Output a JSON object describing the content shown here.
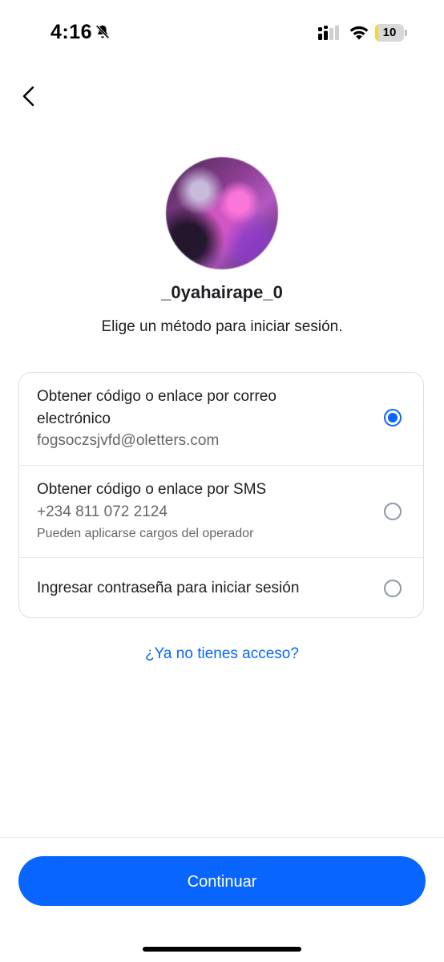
{
  "status_bar": {
    "time": "4:16",
    "battery_level": "10",
    "battery_charge_fraction": 0.1,
    "icons": [
      "bell-off-icon",
      "signal-icon",
      "wifi-icon",
      "battery-icon"
    ]
  },
  "header": {
    "back_icon": "chevron-left-icon"
  },
  "profile": {
    "username": "_0yahairape_0",
    "subtitle": "Elige un método para iniciar sesión."
  },
  "options": [
    {
      "title": "Obtener código o enlace por correo electrónico",
      "detail": "fogsoczsjvfd@oletters.com",
      "selected": true
    },
    {
      "title": "Obtener código o enlace por SMS",
      "detail": "+234 811 072 2124",
      "note": "Pueden aplicarse cargos del operador",
      "selected": false
    },
    {
      "title": "Ingresar contraseña para iniciar sesión",
      "selected": false
    }
  ],
  "help_link": "¿Ya no tienes acceso?",
  "continue_button": "Continuar",
  "colors": {
    "accent": "#0866ff",
    "text_primary": "#1c1e21",
    "text_secondary": "#65676b",
    "battery_fill": "#f7d33e"
  }
}
